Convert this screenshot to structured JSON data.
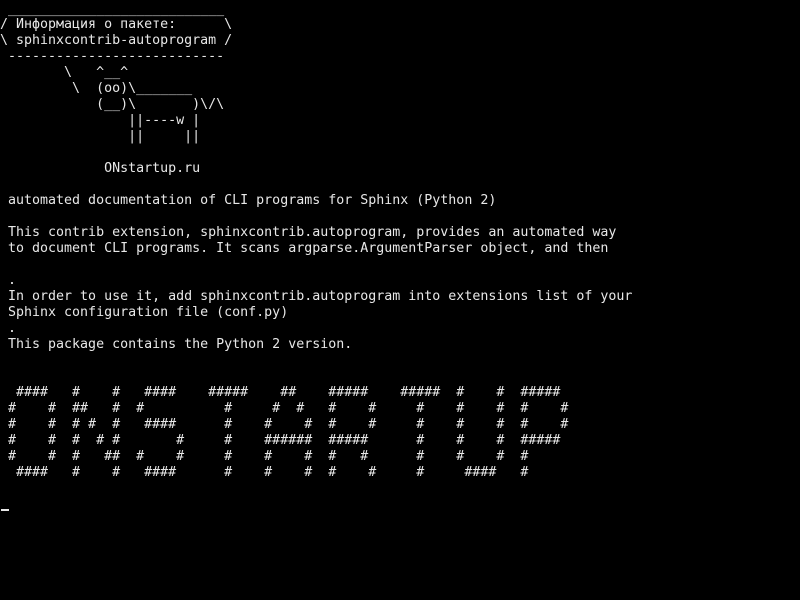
{
  "colors": {
    "background": "#000000",
    "foreground": "#e8e8e8"
  },
  "banner": {
    "top_border": " ___________________________",
    "title_line": "/ Информация о пакете:      \\",
    "package_line": "\\ sphinxcontrib-autoprogram /",
    "bottom_border": " ---------------------------",
    "cow": [
      "        \\   ^__^",
      "         \\  (oo)\\_______",
      "            (__)\\       )\\/\\",
      "                ||----w |",
      "                ||     ||"
    ],
    "site": "             ONstartup.ru"
  },
  "description": {
    "summary": " automated documentation of CLI programs for Sphinx (Python 2)",
    "paragraph1": [
      " This contrib extension, sphinxcontrib.autoprogram, provides an automated way",
      " to document CLI programs. It scans argparse.ArgumentParser object, and then"
    ],
    "separator1": " .",
    "paragraph2": [
      " In order to use it, add sphinxcontrib.autoprogram into extensions list of your",
      " Sphinx configuration file (conf.py)"
    ],
    "separator2": " .",
    "version_note": " This package contains the Python 2 version."
  },
  "ascii_art": [
    "  ####   #    #   ####    #####    ##    #####    #####  #    #  #####",
    " #    #  ##   #  #          #     #  #   #    #     #    #    #  #    #",
    " #    #  # #  #   ####      #    #    #  #    #     #    #    #  #    #",
    " #    #  #  # #       #     #    ######  #####      #    #    #  #####",
    " #    #  #   ##  #    #     #    #    #  #   #      #    #    #  #",
    "  ####   #    #   ####      #    #    #  #    #     #     ####   #"
  ]
}
